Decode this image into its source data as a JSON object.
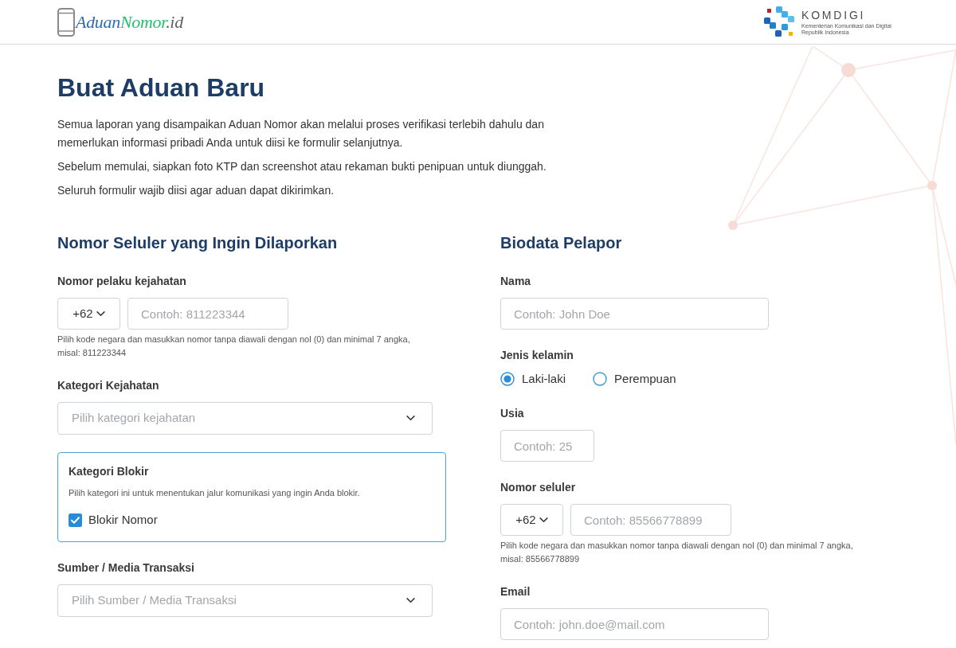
{
  "header": {
    "logo": {
      "parts": [
        {
          "text": "Aduan",
          "color": "#2e6db4"
        },
        {
          "text": "Nomor",
          "color": "#22c16a"
        },
        {
          "text": ".id",
          "color": "#5f6368"
        }
      ]
    },
    "partner_logo": {
      "name": "KOMDIGI",
      "tagline": "Kementerian Komunikasi dan Digital Republik Indonesia"
    }
  },
  "page": {
    "title": "Buat Aduan Baru",
    "intro": [
      "Semua laporan yang disampaikan Aduan Nomor akan melalui proses verifikasi terlebih dahulu dan memerlukan informasi pribadi Anda untuk diisi ke formulir selanjutnya.",
      "Sebelum memulai, siapkan foto KTP dan screenshot atau rekaman bukti penipuan untuk diunggah.",
      "Seluruh formulir wajib diisi agar aduan dapat dikirimkan."
    ]
  },
  "sections": [
    {
      "title": "Nomor Seluler yang Ingin Dilaporkan",
      "fields": [
        {
          "kind": "phone",
          "label": "Nomor pelaku kejahatan",
          "country_code": "+62",
          "placeholder": "Contoh: 811223344",
          "hint": "Pilih kode negara dan masukkan nomor tanpa diawali dengan nol (0) dan minimal 7 angka, misal: 811223344"
        },
        {
          "kind": "select",
          "label": "Kategori Kejahatan",
          "placeholder": "Pilih kategori kejahatan"
        },
        {
          "kind": "panel",
          "title": "Kategori Blokir",
          "description": "Pilih kategori ini untuk menentukan jalur komunikasi yang ingin Anda blokir.",
          "options": [
            {
              "label": "Blokir Nomor",
              "checked": true
            }
          ]
        },
        {
          "kind": "select",
          "label": "Sumber / Media Transaksi",
          "placeholder": "Pilih Sumber / Media Transaksi"
        }
      ]
    },
    {
      "title": "Biodata Pelapor",
      "fields": [
        {
          "kind": "text",
          "label": "Nama",
          "placeholder": "Contoh: John Doe"
        },
        {
          "kind": "radio",
          "label": "Jenis kelamin",
          "options": [
            {
              "label": "Laki-laki",
              "selected": true
            },
            {
              "label": "Perempuan",
              "selected": false
            }
          ]
        },
        {
          "kind": "number",
          "label": "Usia",
          "placeholder": "Contoh: 25"
        },
        {
          "kind": "phone",
          "label": "Nomor seluler",
          "country_code": "+62",
          "placeholder": "Contoh: 85566778899",
          "hint": "Pilih kode negara dan masukkan nomor tanpa diawali dengan nol (0) dan minimal 7 angka, misal: 85566778899"
        },
        {
          "kind": "email",
          "label": "Email",
          "placeholder": "Contoh: john.doe@mail.com"
        }
      ]
    }
  ]
}
